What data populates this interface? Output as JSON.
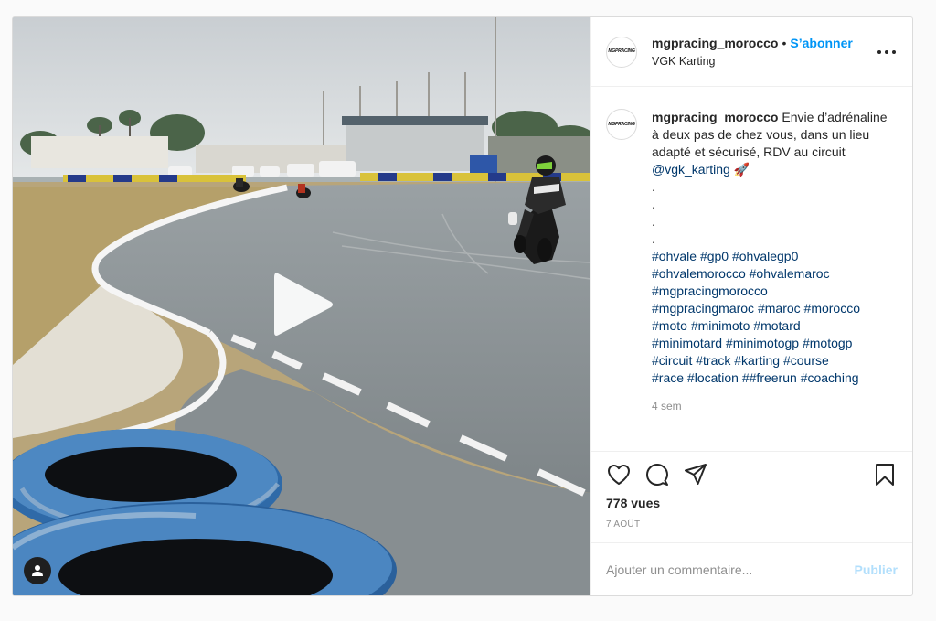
{
  "post": {
    "header": {
      "logo_text": "MGPRACING",
      "username": "mgpracing_morocco",
      "separator": "•",
      "follow_label": "S’abonner",
      "location": "VGK Karting",
      "more_icon": "more-horizontal-icon"
    },
    "media": {
      "type": "video",
      "play_icon": "play-icon",
      "user_badge_icon": "user-icon"
    },
    "caption": {
      "username": "mgpracing_morocco",
      "text": "Envie d’adrénaline à deux pas de chez vous, dans un lieu adapté et sécurisé, RDV au circuit",
      "mention": "@vgk_karting",
      "emoji": "🚀",
      "dots": [
        ".",
        ".",
        ".",
        "."
      ],
      "hashtags": [
        "#ohvale",
        "#gp0",
        "#ohvalegp0",
        "#ohvalemorocco",
        "#ohvalemaroc",
        "#mgpracingmorocco",
        "#mgpracingmaroc",
        "#maroc",
        "#morocco",
        "#moto",
        "#minimoto",
        "#motard",
        "#minimotard",
        "#minimotogp",
        "#motogp",
        "#circuit",
        "#track",
        "#karting",
        "#course",
        "#race",
        "#location",
        "##freerun",
        "#coaching"
      ],
      "time_ago": "4 sem"
    },
    "actions": {
      "like_icon": "heart-icon",
      "comment_icon": "comment-icon",
      "share_icon": "send-icon",
      "save_icon": "bookmark-icon",
      "views": "778 vues",
      "date": "7 AOÛT"
    },
    "comment": {
      "placeholder": "Ajouter un commentaire...",
      "publish_label": "Publier"
    }
  },
  "colors": {
    "link_blue": "#0095f6",
    "hashtag_blue": "#00376b",
    "muted_gray": "#8e8e8e",
    "publish_disabled": "#b2dffc",
    "border": "#dbdbdb"
  }
}
